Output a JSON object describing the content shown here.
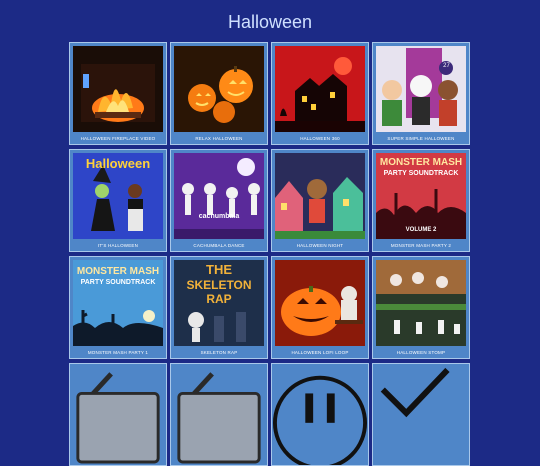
{
  "page": {
    "title": "Halloween"
  },
  "tiles": [
    {
      "caption": "HALLOWEEN FIREPLACE VIDEO",
      "icon": "fireplace-thumbnail"
    },
    {
      "caption": "RELAX HALLOWEEN",
      "icon": "pumpkins-thumbnail"
    },
    {
      "caption": "HALLOWEEN 360",
      "icon": "haunted-house-thumbnail"
    },
    {
      "caption": "SUPER SIMPLE HALLOWEEN",
      "icon": "cartoon-kids-thumbnail",
      "badge": "27"
    },
    {
      "caption": "IT'S HALLOWEEN",
      "icon": "halloween-kids-thumbnail",
      "heading": "Halloween"
    },
    {
      "caption": "CACHUMBALA DANCE",
      "icon": "skeletons-thumbnail",
      "label": "cachumbala"
    },
    {
      "caption": "HALLOWEEN NIGHT",
      "icon": "cartoon-town-thumbnail"
    },
    {
      "caption": "MONSTER MASH PARTY 2",
      "icon": "monster-mash-2-thumbnail",
      "heading": "MONSTER MASH",
      "sub": "PARTY SOUNDTRACK",
      "extra": "VOLUME 2"
    },
    {
      "caption": "MONSTER MASH PARTY 1",
      "icon": "monster-mash-1-thumbnail",
      "heading": "MONSTER MASH",
      "sub": "PARTY SOUNDTRACK"
    },
    {
      "caption": "SKELETON RAP",
      "icon": "skeleton-rap-thumbnail",
      "heading": "THE",
      "sub": "SKELETON RAP"
    },
    {
      "caption": "HALLOWEEN LOFI LOOP",
      "icon": "jack-o-lantern-thumbnail"
    },
    {
      "caption": "HALLOWEEN STOMP",
      "icon": "cartoon-stage-thumbnail"
    },
    {
      "caption": "",
      "icon": "edit-icon"
    },
    {
      "caption": "",
      "icon": "edit-icon"
    },
    {
      "caption": "",
      "icon": "pause-icon"
    },
    {
      "caption": "",
      "icon": "check-icon"
    }
  ]
}
